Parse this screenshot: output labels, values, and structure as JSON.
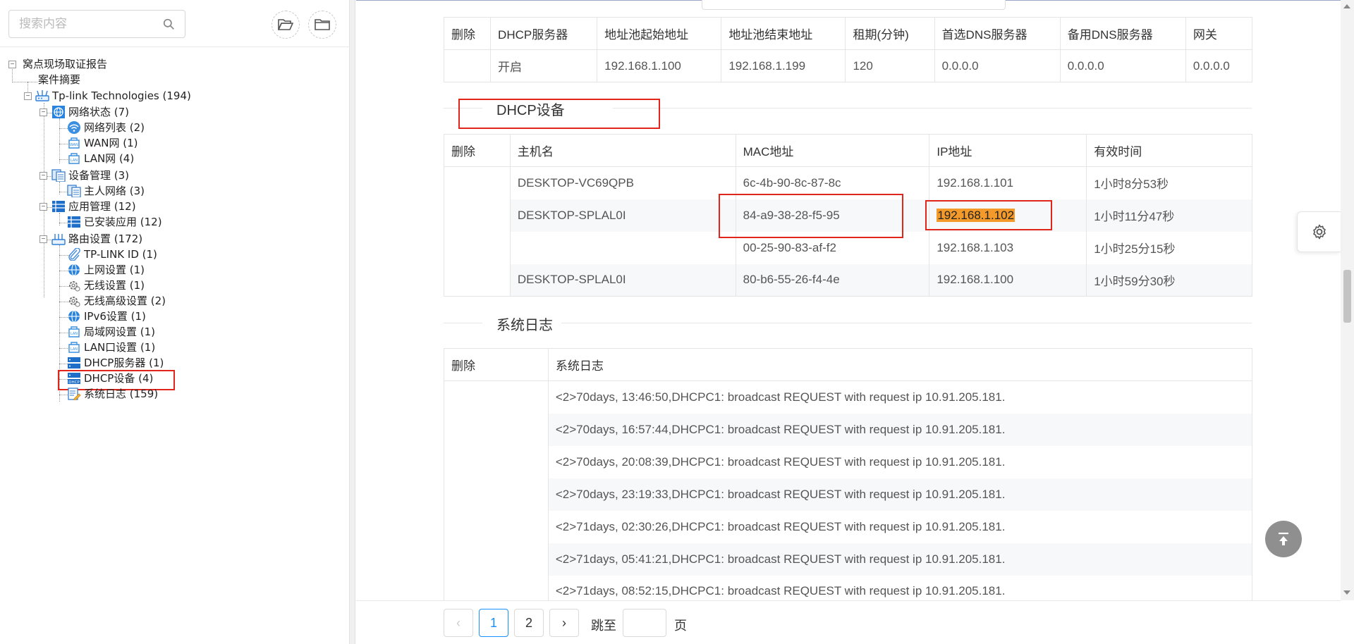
{
  "search": {
    "placeholder": "搜索内容"
  },
  "tree": {
    "root": "窝点现场取证报告",
    "case_summary": "案件摘要",
    "device": "Tp-link Technologies (194)",
    "network_status": "网络状态 (7)",
    "network_list": "网络列表 (2)",
    "wan": "WAN网 (1)",
    "lan": "LAN网 (4)",
    "device_mgmt": "设备管理 (3)",
    "host_network": "主人网络 (3)",
    "app_mgmt": "应用管理 (12)",
    "installed_apps": "已安装应用 (12)",
    "router_settings": "路由设置 (172)",
    "tplink_id": "TP-LINK ID (1)",
    "internet_settings": "上网设置 (1)",
    "wireless_settings": "无线设置 (1)",
    "wireless_adv": "无线高级设置 (2)",
    "ipv6": "IPv6设置 (1)",
    "lan_settings": "局域网设置 (1)",
    "lan_port": "LAN口设置 (1)",
    "dhcp_server": "DHCP服务器 (1)",
    "dhcp_devices": "DHCP设备 (4)",
    "system_log": "系统日志 (159)"
  },
  "dhcp_server_table": {
    "headers": [
      "删除",
      "DHCP服务器",
      "地址池起始地址",
      "地址池结束地址",
      "租期(分钟)",
      "首选DNS服务器",
      "备用DNS服务器",
      "网关"
    ],
    "rows": [
      [
        "",
        "开启",
        "192.168.1.100",
        "192.168.1.199",
        "120",
        "0.0.0.0",
        "0.0.0.0",
        "0.0.0.0"
      ]
    ]
  },
  "dhcp_devices_section": {
    "title": "DHCP设备"
  },
  "dhcp_devices_table": {
    "headers": [
      "删除",
      "主机名",
      "MAC地址",
      "IP地址",
      "有效时间"
    ],
    "rows": [
      [
        "",
        "DESKTOP-VC69QPB",
        "6c-4b-90-8c-87-8c",
        "192.168.1.101",
        "1小时8分53秒"
      ],
      [
        "",
        "DESKTOP-SPLAL0I",
        "84-a9-38-28-f5-95",
        "192.168.1.102",
        "1小时11分47秒"
      ],
      [
        "",
        "",
        "00-25-90-83-af-f2",
        "192.168.1.103",
        "1小时25分15秒"
      ],
      [
        "",
        "DESKTOP-SPLAL0I",
        "80-b6-55-26-f4-4e",
        "192.168.1.100",
        "1小时59分30秒"
      ]
    ]
  },
  "system_log_section": {
    "title": "系统日志"
  },
  "system_log_table": {
    "headers": [
      "删除",
      "系统日志"
    ],
    "rows": [
      "<2>70days, 13:46:50,DHCPC1: broadcast REQUEST with request ip 10.91.205.181.",
      "<2>70days, 16:57:44,DHCPC1: broadcast REQUEST with request ip 10.91.205.181.",
      "<2>70days, 20:08:39,DHCPC1: broadcast REQUEST with request ip 10.91.205.181.",
      "<2>70days, 23:19:33,DHCPC1: broadcast REQUEST with request ip 10.91.205.181.",
      "<2>71days, 02:30:26,DHCPC1: broadcast REQUEST with request ip 10.91.205.181.",
      "<2>71days, 05:41:21,DHCPC1: broadcast REQUEST with request ip 10.91.205.181.",
      "<2>71days, 08:52:15,DHCPC1: broadcast REQUEST with request ip 10.91.205.181."
    ]
  },
  "pagination": {
    "prev": "‹",
    "pages": [
      "1",
      "2"
    ],
    "current": "1",
    "next": "›",
    "jump_label": "跳至",
    "page_suffix": "页",
    "jump_value": ""
  },
  "colors": {
    "highlight": "#f49a2a",
    "annotation_red": "#e1251b",
    "active_blue": "#1890ff"
  },
  "icons": {
    "search": "search-icon",
    "open_folder": "folder-open-icon",
    "folder": "folder-icon",
    "settings": "gear-icon",
    "back_to_top": "arrow-up-to-line-icon"
  }
}
